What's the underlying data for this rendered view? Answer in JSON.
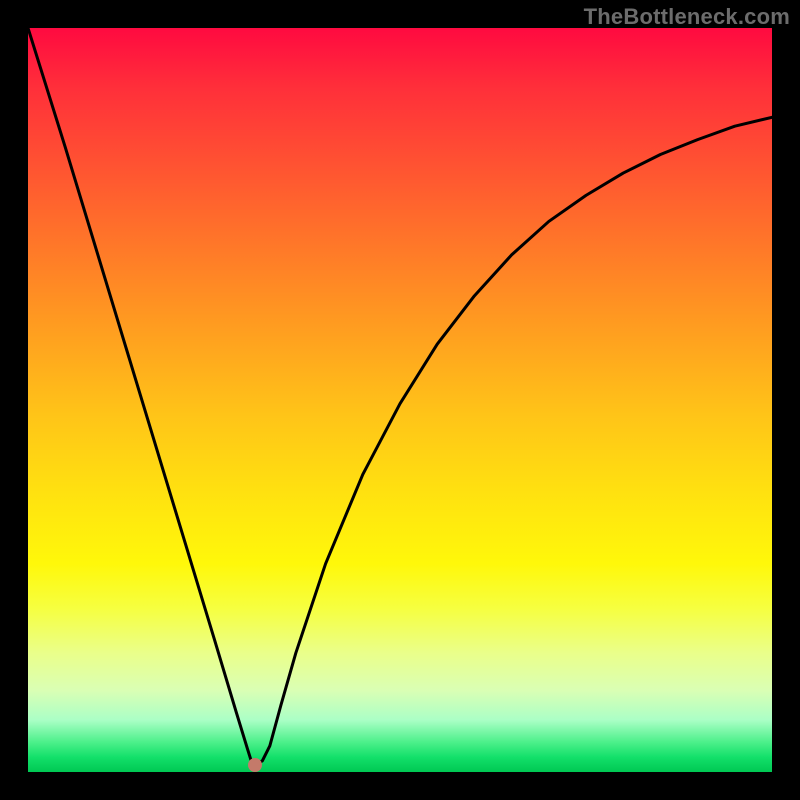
{
  "attribution": "TheBottleneck.com",
  "chart_data": {
    "type": "line",
    "title": "",
    "xlabel": "",
    "ylabel": "",
    "xlim": [
      0,
      100
    ],
    "ylim": [
      0,
      100
    ],
    "background_gradient": {
      "direction": "top-to-bottom",
      "stops": [
        {
          "pos": 0,
          "color": "#ff0a40"
        },
        {
          "pos": 18,
          "color": "#ff5132"
        },
        {
          "pos": 40,
          "color": "#ff9c20"
        },
        {
          "pos": 62,
          "color": "#ffe010"
        },
        {
          "pos": 78,
          "color": "#f6ff40"
        },
        {
          "pos": 93,
          "color": "#abffc6"
        },
        {
          "pos": 100,
          "color": "#00c853"
        }
      ]
    },
    "series": [
      {
        "name": "bottleneck-curve",
        "color": "#000000",
        "x": [
          0.0,
          5.0,
          10.0,
          15.0,
          20.0,
          25.0,
          28.0,
          29.5,
          30.0,
          31.0,
          31.5,
          32.5,
          34.0,
          36.0,
          40.0,
          45.0,
          50.0,
          55.0,
          60.0,
          65.0,
          70.0,
          75.0,
          80.0,
          85.0,
          90.0,
          95.0,
          100.0
        ],
        "y": [
          100.0,
          84.0,
          67.5,
          51.0,
          34.5,
          18.0,
          8.0,
          3.1,
          1.5,
          1.2,
          1.5,
          3.5,
          9.0,
          16.0,
          28.0,
          40.0,
          49.5,
          57.5,
          64.0,
          69.5,
          74.0,
          77.5,
          80.5,
          83.0,
          85.0,
          86.8,
          88.0
        ]
      }
    ],
    "marker": {
      "name": "optimal-point",
      "x": 30.5,
      "y": 1.0,
      "color": "#c47a6a"
    }
  }
}
